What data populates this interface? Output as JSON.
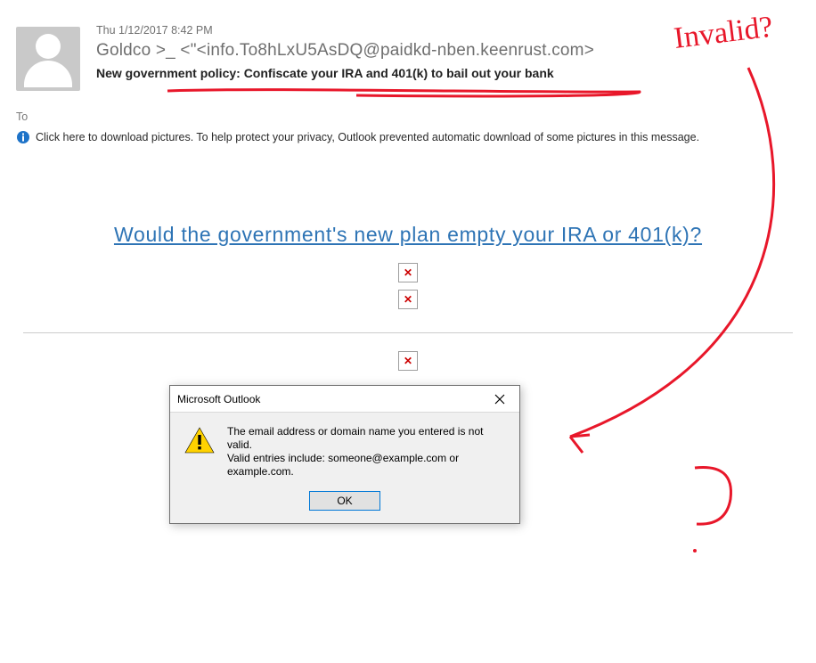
{
  "email": {
    "date": "Thu 1/12/2017 8:42 PM",
    "from": "Goldco >_ <\"<info.To8hLxU5AsDQ@paidkd-nben.keenrust.com>",
    "subject": "New government policy: Confiscate your IRA and 401(k) to bail out your bank",
    "to_label": "To",
    "infobar": "Click here to download pictures. To help protect your privacy, Outlook prevented automatic download of some pictures in this message.",
    "main_link": "Would the government's new plan empty your IRA or 401(k)?"
  },
  "dialog": {
    "title": "Microsoft Outlook",
    "line1": "The email address or domain name you entered is not valid.",
    "line2": "Valid entries include: someone@example.com or example.com.",
    "ok": "OK"
  },
  "annotation": {
    "label": "Invalid?"
  }
}
